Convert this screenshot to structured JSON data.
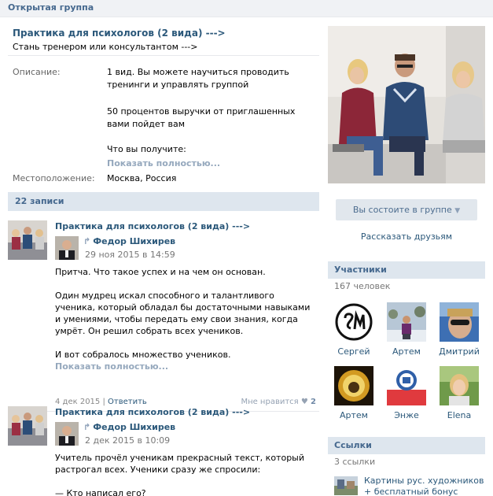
{
  "topbar": {
    "title": "Открытая группа"
  },
  "group": {
    "title": "Практика для психологов (2 вида) --->",
    "status": "Стань тренером или консультантом --->",
    "description_label": "Описание:",
    "description_lines": [
      "1 вид. Вы можете научиться проводить тренинги и управлять группой",
      "50 процентов выручки от приглашенных вами пойдет вам",
      "Что вы получите:"
    ],
    "show_more": "Показать полностью...",
    "location_label": "Местоположение:",
    "location_value": "Москва, Россия"
  },
  "posts_header": "22 записи",
  "posts": [
    {
      "group": "Практика для психологов (2 вида) --->",
      "author": "Федор Шихирев",
      "date": "29 ноя 2015 в 14:59",
      "paragraphs": [
        "Притча. Что такое успех и на чем он основан.",
        "Один мудрец искал способного и талантливого ученика, который обладал бы достаточными навыками и умениями, чтобы передать ему свои знания, когда умрёт. Он решил собрать всех учеников.",
        "И вот собралось множество учеников."
      ],
      "show_more": "Показать полностью...",
      "foot_date": "4 дек 2015",
      "reply": "Ответить",
      "like_label": "Мне нравится",
      "like_count": "2"
    },
    {
      "group": "Практика для психологов (2 вида) --->",
      "author": "Федор Шихирев",
      "date": "2 дек 2015 в 10:09",
      "paragraphs": [
        "Учитель прочёл ученикам прекрасный текст, который растрогал всех. Ученики сразу же спросили:",
        "— Кто написал его?"
      ]
    }
  ],
  "sidebar": {
    "member_button": "Вы состоите в группе",
    "tell_friends": "Рассказать друзьям",
    "members_title": "Участники",
    "members_count": "167 человек",
    "members": [
      {
        "name": "Сергей"
      },
      {
        "name": "Артем"
      },
      {
        "name": "Дмитрий"
      },
      {
        "name": "Артем"
      },
      {
        "name": "Энже"
      },
      {
        "name": "Elena"
      }
    ],
    "links_title": "Ссылки",
    "links_count": "3 ссылки",
    "link_text": "Картины рус. художников + бесплатный бонус"
  },
  "colors": {
    "link": "#2b587a",
    "header_bg": "#dee6ee",
    "header_text": "#45688e",
    "muted": "#95a8bd"
  }
}
